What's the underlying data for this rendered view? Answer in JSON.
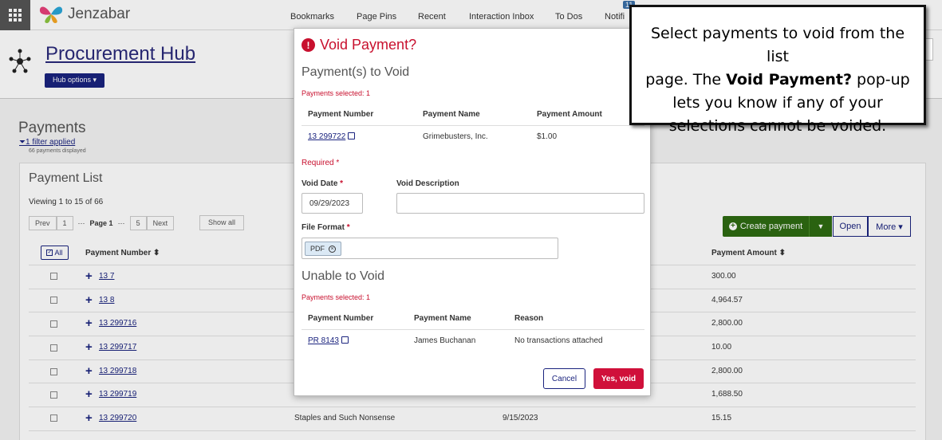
{
  "topbar": {
    "logo_text": "Jenzabar",
    "nav": [
      "Bookmarks",
      "Page Pins",
      "Recent",
      "Interaction Inbox",
      "To Dos",
      "Notifi"
    ],
    "badge": "11"
  },
  "hub": {
    "title": "Procurement Hub",
    "options_label": "Hub options ▾"
  },
  "payments": {
    "heading": "Payments",
    "filter_link": "1 filter applied",
    "filter_sub": "66 payments displayed",
    "list_title": "Payment List",
    "viewing": "Viewing 1 to 15 of 66",
    "pager": {
      "prev": "Prev",
      "first": "1",
      "ellipsis": "···",
      "page": "Page 1",
      "last": "5",
      "next": "Next",
      "show_all": "Show all"
    },
    "actions": {
      "create": "Create payment",
      "open": "Open",
      "more": "More ▾"
    },
    "all_label": "All",
    "col_number": "Payment Number ⬍",
    "col_amount": "Payment Amount ⬍",
    "rows": [
      {
        "number": "13 7",
        "amount": "300.00",
        "name": "",
        "date": ""
      },
      {
        "number": "13 8",
        "amount": "4,964.57",
        "name": "",
        "date": ""
      },
      {
        "number": "13 299716",
        "amount": "2,800.00",
        "name": "",
        "date": ""
      },
      {
        "number": "13 299717",
        "amount": "10.00",
        "name": "",
        "date": ""
      },
      {
        "number": "13 299718",
        "amount": "2,800.00",
        "name": "",
        "date": ""
      },
      {
        "number": "13 299719",
        "amount": "1,688.50",
        "name": "",
        "date": ""
      },
      {
        "number": "13 299720",
        "amount": "15.15",
        "name": "Staples and Such Nonsense",
        "date": "9/15/2023"
      }
    ]
  },
  "modal": {
    "title": "Void Payment?",
    "to_void_heading": "Payment(s) to Void",
    "selected_1": "Payments selected: 1",
    "cols1": [
      "Payment Number",
      "Payment Name",
      "Payment Amount"
    ],
    "void_row": {
      "number": "13 299722",
      "name": "Grimebusters, Inc.",
      "amount": "$1.00"
    },
    "required": "Required",
    "void_date_label": "Void Date",
    "void_date_value": "09/29/2023",
    "void_desc_label": "Void Description",
    "void_desc_value": "",
    "file_format_label": "File Format",
    "file_format_chip": "PDF",
    "unable_heading": "Unable to Void",
    "selected_2": "Payments selected: 1",
    "cols2": [
      "Payment Number",
      "Payment Name",
      "Reason"
    ],
    "unable_row": {
      "number": "PR 8143",
      "name": "James Buchanan",
      "reason": "No transactions attached"
    },
    "cancel": "Cancel",
    "confirm": "Yes, void"
  },
  "callout": {
    "line1": "Select payments to void from the list",
    "line2_pre": "page. The ",
    "line2_bold": "Void Payment?",
    "line2_post": " pop-up",
    "line3": "lets you know if any of your",
    "line4": "selections cannot be voided."
  },
  "colors": {
    "accent": "#1a237e",
    "danger": "#c8102e",
    "create": "#2e6b12"
  }
}
